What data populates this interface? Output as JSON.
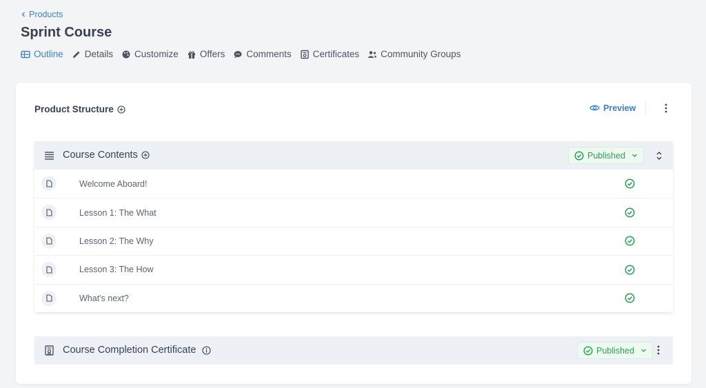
{
  "breadcrumb": {
    "back_label": "Products"
  },
  "page": {
    "title": "Sprint Course"
  },
  "tabs": [
    {
      "label": "Outline",
      "icon": "outline-icon",
      "active": true
    },
    {
      "label": "Details",
      "icon": "pencil-icon",
      "active": false
    },
    {
      "label": "Customize",
      "icon": "palette-icon",
      "active": false
    },
    {
      "label": "Offers",
      "icon": "gift-icon",
      "active": false
    },
    {
      "label": "Comments",
      "icon": "comment-icon",
      "active": false
    },
    {
      "label": "Certificates",
      "icon": "certificate-icon",
      "active": false
    },
    {
      "label": "Community Groups",
      "icon": "users-icon",
      "active": false
    }
  ],
  "structure": {
    "title": "Product Structure",
    "preview_label": "Preview"
  },
  "course_contents": {
    "title": "Course Contents",
    "status": "Published",
    "lessons": [
      {
        "title": "Welcome Aboard!",
        "published": true
      },
      {
        "title": "Lesson 1: The What",
        "published": true
      },
      {
        "title": "Lesson 2: The Why",
        "published": true
      },
      {
        "title": "Lesson 3: The How",
        "published": true
      },
      {
        "title": "What's next?",
        "published": true
      }
    ]
  },
  "certificate": {
    "title": "Course Completion Certificate",
    "status": "Published"
  },
  "colors": {
    "accent": "#3b82c4",
    "published_green": "#2ea05a",
    "page_bg": "#f3f4f6",
    "section_header_bg": "#edf1f5"
  }
}
